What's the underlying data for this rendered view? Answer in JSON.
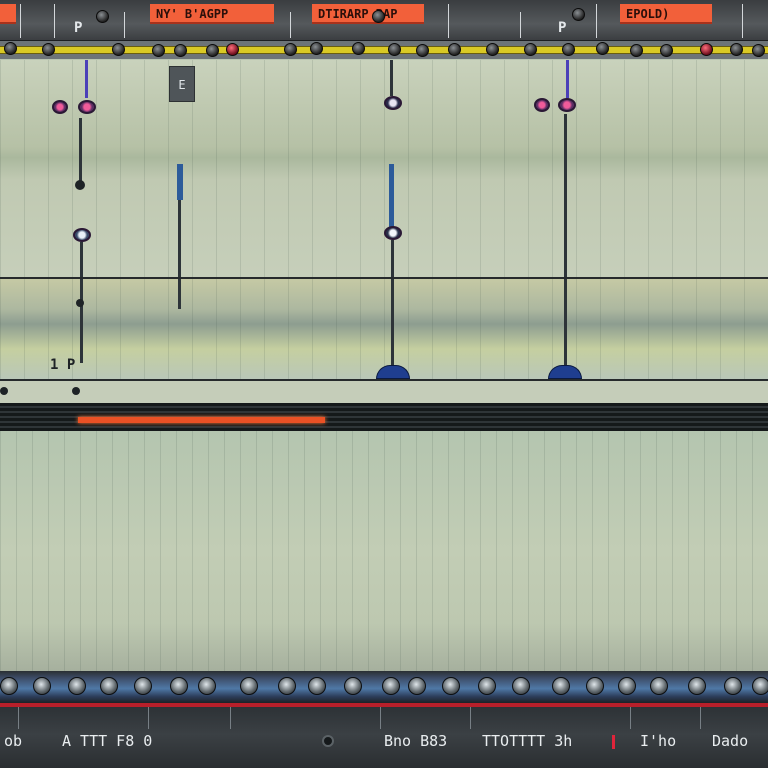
{
  "top_ruler": {
    "markers": [
      {
        "label": "NY' B'AGPP"
      },
      {
        "label": "DTIRARP BAP"
      },
      {
        "label": "EPOLD)"
      }
    ],
    "small_marks": [
      "P",
      "P"
    ]
  },
  "lane_1": {
    "clip_tag": "E"
  },
  "lane_2": {
    "marker_text": "1 P"
  },
  "footer": {
    "labels": [
      {
        "text": "ob"
      },
      {
        "text": "A TTT F8 0"
      },
      {
        "text": "Bno B83"
      },
      {
        "text": "TTOTTTT 3h"
      },
      {
        "text": "I'ho"
      },
      {
        "text": "Dado"
      }
    ]
  },
  "colors": {
    "marker_bg": "#f2603a",
    "cue_band": "#d9c925",
    "scrub_bar": "#ea5125",
    "rail_blue": "#4f78a6",
    "hook_pink": "#f05b9a"
  }
}
